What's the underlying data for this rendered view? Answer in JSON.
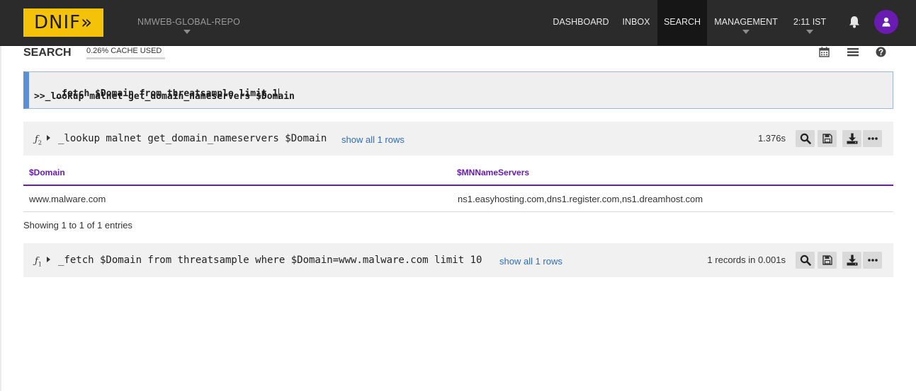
{
  "app": {
    "logo_text": "DNIF»",
    "repo_name": "NMWEB-GLOBAL-REPO"
  },
  "nav": {
    "dashboard": "DASHBOARD",
    "inbox": "INBOX",
    "search": "SEARCH",
    "management": "MANAGEMENT",
    "time": "2:11 IST",
    "active_item": "SEARCH"
  },
  "colors": {
    "brand_yellow": "#f5c20a",
    "accent_purple": "#6a1bb1",
    "link_blue": "#2d6cc0",
    "editor_border": "#5b8fd6"
  },
  "page": {
    "title": "SEARCH",
    "cache_label": "0.26% CACHE USED"
  },
  "header_icons": [
    "calendar-icon",
    "list-icon",
    "help-icon"
  ],
  "editor": {
    "line1": "_fetch $Domain from threatsample limit 1",
    "line2": ">>_lookup malnet get_domain_nameservers $Domain"
  },
  "result2": {
    "fx_label": "ƒ",
    "fx_index": "2",
    "query": "_lookup malnet get_domain_nameservers $Domain",
    "show_all": "show all 1 rows",
    "timing": "1.376s",
    "columns": [
      "$Domain",
      "$MNNameServers"
    ],
    "rows": [
      [
        "www.malware.com",
        "ns1.easyhosting.com,dns1.register.com,ns1.dreamhost.com"
      ]
    ],
    "entries": "Showing 1 to 1 of 1 entries"
  },
  "result1": {
    "fx_label": "ƒ",
    "fx_index": "1",
    "query": "_fetch $Domain from threatsample where $Domain=www.malware.com limit 10",
    "show_all": "show all 1 rows",
    "timing": "1 records in 0.001s"
  },
  "panel_actions": [
    "search-icon",
    "save-icon",
    "download-icon",
    "more-icon"
  ]
}
